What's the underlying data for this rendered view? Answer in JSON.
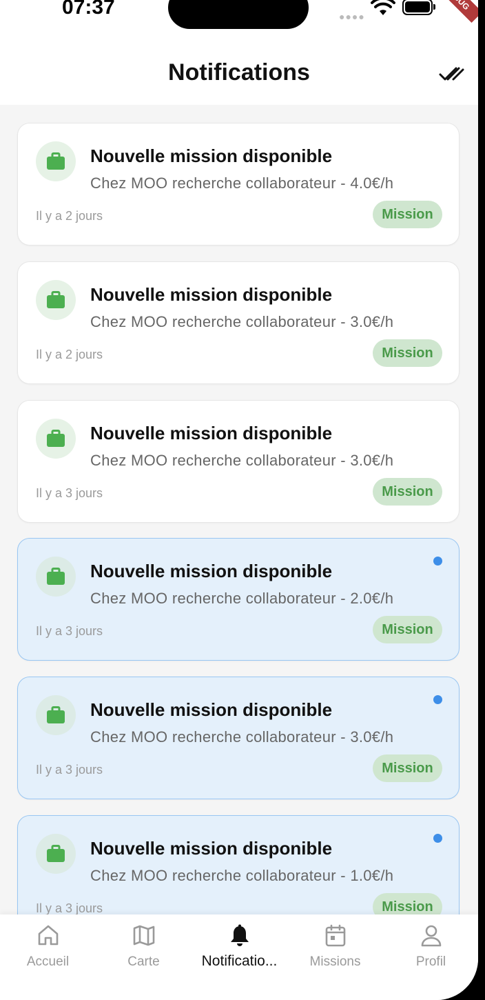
{
  "status_bar": {
    "time": "07:37",
    "debug_banner": "DEBUG",
    "colors": {
      "debug": "#b03a3a"
    }
  },
  "header": {
    "title": "Notifications",
    "action_icon": "double-check-icon"
  },
  "notifications": [
    {
      "title": "Nouvelle mission disponible",
      "body": "Chez MOO recherche collaborateur - 4.0€/h",
      "time": "Il y a 2 jours",
      "badge": "Mission",
      "unread": false,
      "icon": "briefcase-icon"
    },
    {
      "title": "Nouvelle mission disponible",
      "body": "Chez MOO recherche collaborateur - 3.0€/h",
      "time": "Il y a 2 jours",
      "badge": "Mission",
      "unread": false,
      "icon": "briefcase-icon"
    },
    {
      "title": "Nouvelle mission disponible",
      "body": "Chez MOO recherche collaborateur - 3.0€/h",
      "time": "Il y a 3 jours",
      "badge": "Mission",
      "unread": false,
      "icon": "briefcase-icon"
    },
    {
      "title": "Nouvelle mission disponible",
      "body": "Chez MOO recherche collaborateur - 2.0€/h",
      "time": "Il y a 3 jours",
      "badge": "Mission",
      "unread": true,
      "icon": "briefcase-icon"
    },
    {
      "title": "Nouvelle mission disponible",
      "body": "Chez MOO recherche collaborateur - 3.0€/h",
      "time": "Il y a 3 jours",
      "badge": "Mission",
      "unread": true,
      "icon": "briefcase-icon"
    },
    {
      "title": "Nouvelle mission disponible",
      "body": "Chez MOO recherche collaborateur - 1.0€/h",
      "time": "Il y a 3 jours",
      "badge": "Mission",
      "unread": true,
      "icon": "briefcase-icon"
    }
  ],
  "bottom_nav": [
    {
      "label": "Accueil",
      "icon": "home-icon",
      "active": false
    },
    {
      "label": "Carte",
      "icon": "map-icon",
      "active": false
    },
    {
      "label": "Notificatio...",
      "icon": "bell-icon",
      "active": true
    },
    {
      "label": "Missions",
      "icon": "calendar-icon",
      "active": false
    },
    {
      "label": "Profil",
      "icon": "user-icon",
      "active": false
    }
  ],
  "colors": {
    "accent_green": "#4caf50",
    "badge_bg": "#cfe6cf",
    "unread_bg": "#e4f0fb",
    "unread_dot": "#3d8ee8",
    "inactive": "#9a9a9a"
  }
}
